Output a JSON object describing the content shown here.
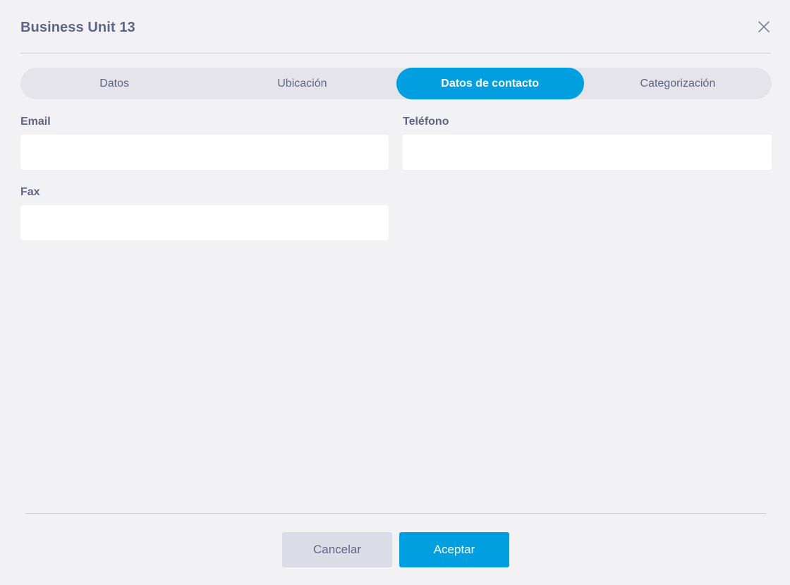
{
  "dialog": {
    "title": "Business Unit 13",
    "close_icon": "close-icon"
  },
  "tabs": [
    {
      "label": "Datos",
      "active": false
    },
    {
      "label": "Ubicación",
      "active": false
    },
    {
      "label": "Datos de contacto",
      "active": true
    },
    {
      "label": "Categorización",
      "active": false
    }
  ],
  "form": {
    "email": {
      "label": "Email",
      "value": ""
    },
    "telefono": {
      "label": "Teléfono",
      "value": ""
    },
    "fax": {
      "label": "Fax",
      "value": ""
    }
  },
  "footer": {
    "cancel_label": "Cancelar",
    "accept_label": "Aceptar"
  },
  "colors": {
    "accent": "#009fdf",
    "text": "#5f6585",
    "background": "#f2f2f5"
  }
}
